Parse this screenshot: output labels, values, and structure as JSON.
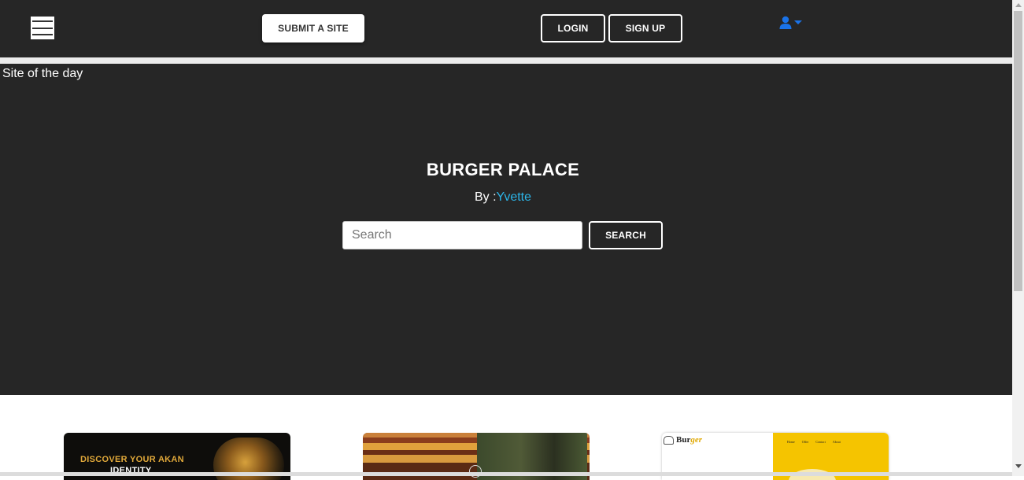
{
  "header": {
    "menu_icon": "hamburger-menu-icon",
    "submit_label": "SUBMIT A SITE",
    "login_label": "LOGIN",
    "signup_label": "SIGN UP",
    "user_icon": "user-icon",
    "user_caret_icon": "caret-down-icon"
  },
  "hero": {
    "label": "Site of the day",
    "title": "BURGER PALACE",
    "by_prefix": "By :",
    "author": "Yvette",
    "search_placeholder": "Search",
    "search_button": "SEARCH"
  },
  "cards": [
    {
      "text_line1": "DISCOVER YOUR AKAN",
      "text_line2": "IDENTITY"
    },
    {
      "media_icon": "play-icon"
    },
    {
      "logo_prefix": "Bur",
      "logo_suffix": "ger",
      "logo_icon": "burger-icon",
      "nav": [
        "Home",
        "Offer",
        "Contact",
        "About"
      ]
    }
  ],
  "colors": {
    "dark_bg": "#262626",
    "author_link": "#2cb5e8",
    "user_icon": "#1a73e8",
    "card3_accent": "#f5c400"
  }
}
